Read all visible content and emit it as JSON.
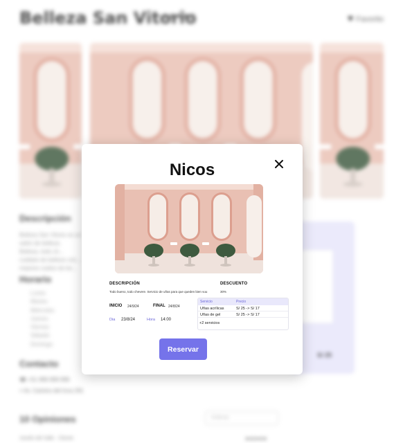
{
  "background": {
    "title": "Belleza San Vitorio",
    "rating_stars": "★★★★★",
    "favorite_label": "Favorito",
    "sections": {
      "description": "Descripción",
      "schedule": "Horario",
      "contact": "Contacto",
      "reviews": "10 Opiniones"
    },
    "description_text": "Belleza San Vitorio es un salón de belleza. Belleza, todo ch... cuidado de belleza con... mejores cuidos de be...",
    "days": [
      "Lunes",
      "Martes",
      "Miércoles",
      "Jueves",
      "Viernes",
      "Sábado",
      "Domingo"
    ],
    "contact": {
      "phone": "+51 999 999 999",
      "address": "Av. Camino del Inca 291"
    },
    "sort_placeholder": "Ordenar",
    "review_author": "Joselin del Valle · Cliente",
    "review_stars": "★★★★★",
    "panel_price": "S/ 25"
  },
  "modal": {
    "title": "Nicos",
    "description_label": "DESCRIPCIÓN",
    "description_text": "Todo bueno, todo chevere. Servicio de uñas para que queden bien vuu",
    "discount_label": "DESCUENTO",
    "discount_value": "30%",
    "start_label": "INICIO",
    "start_date": "24/9/24",
    "end_label": "FINAL",
    "end_date": "24/8/24",
    "day_label": "Dia",
    "day_value": "23/8/24",
    "hour_label": "Hora",
    "hour_value": "14:00",
    "services": {
      "headers": [
        "Servicio",
        "Precio"
      ],
      "rows": [
        {
          "name": "Uñas acrílicas",
          "price": "S/ 25 -> S/ 17"
        },
        {
          "name": "Uñas de gel",
          "price": "S/ 25 -> S/ 17"
        }
      ],
      "more": "+2 servicios"
    },
    "button_label": "Reservar"
  },
  "colors": {
    "accent": "#7573ea",
    "accent_light": "#e9e8fb",
    "salon_wall": "#e8bcae",
    "salon_chair": "#3e5a3f"
  }
}
